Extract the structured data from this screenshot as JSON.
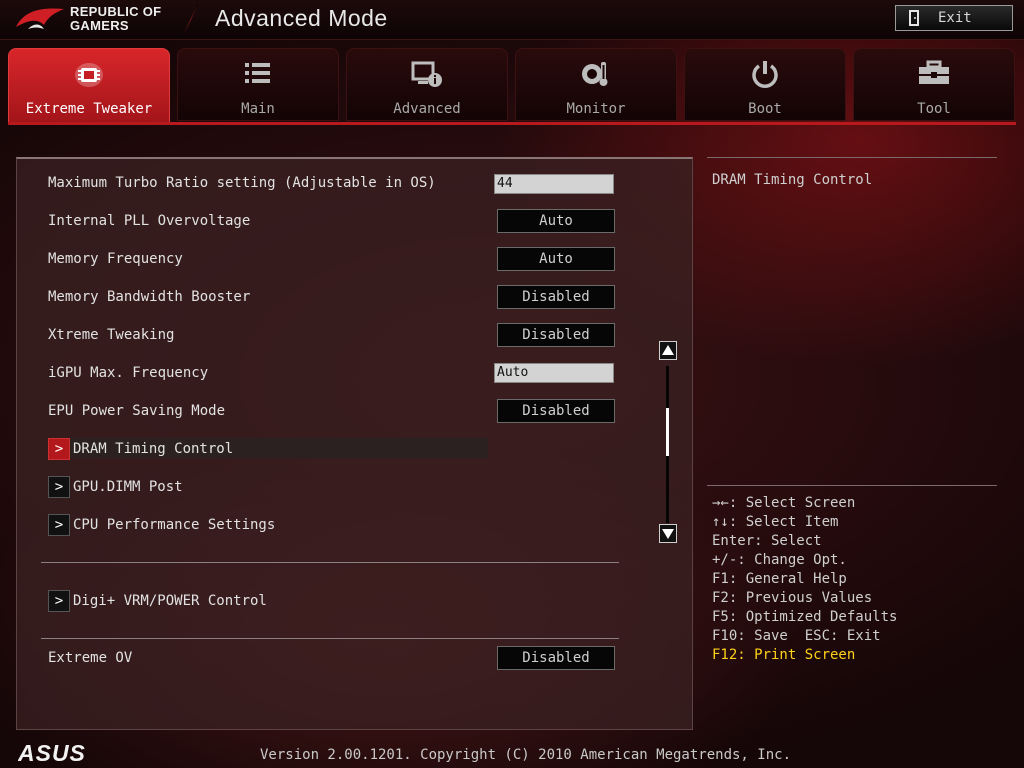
{
  "header": {
    "brand_line1": "REPUBLIC OF",
    "brand_line2": "GAMERS",
    "mode_title": "Advanced Mode",
    "exit_label": "Exit"
  },
  "tabs": [
    {
      "label": "Extreme Tweaker",
      "icon": "tweaker-icon",
      "active": true
    },
    {
      "label": "Main",
      "icon": "list-icon",
      "active": false
    },
    {
      "label": "Advanced",
      "icon": "advanced-info-icon",
      "active": false
    },
    {
      "label": "Monitor",
      "icon": "thermometer-icon",
      "active": false
    },
    {
      "label": "Boot",
      "icon": "power-icon",
      "active": false
    },
    {
      "label": "Tool",
      "icon": "toolbox-icon",
      "active": false
    }
  ],
  "settings": {
    "max_turbo": {
      "label": "Maximum Turbo Ratio setting (Adjustable in OS)",
      "value": "44"
    },
    "pll_overvoltage": {
      "label": "Internal PLL Overvoltage",
      "value": "Auto"
    },
    "memory_frequency": {
      "label": "Memory Frequency",
      "value": "Auto"
    },
    "memory_bandwidth_booster": {
      "label": "Memory Bandwidth Booster",
      "value": "Disabled"
    },
    "xtreme_tweaking": {
      "label": "Xtreme Tweaking",
      "value": "Disabled"
    },
    "igpu_max_frequency": {
      "label": "iGPU Max. Frequency",
      "value": "Auto"
    },
    "epu_power_saving": {
      "label": "EPU Power Saving Mode",
      "value": "Disabled"
    },
    "extreme_ov": {
      "label": "Extreme OV",
      "value": "Disabled"
    }
  },
  "submenus": {
    "dram_timing": "DRAM Timing Control",
    "gpu_dimm_post": "GPU.DIMM Post",
    "cpu_performance": "CPU Performance Settings",
    "digi_vrm": "Digi+ VRM/POWER Control"
  },
  "help": {
    "title": "DRAM Timing Control",
    "keys": [
      "→←: Select Screen",
      "↑↓: Select Item",
      "Enter: Select",
      "+/-: Change Opt.",
      "F1: General Help",
      "F2: Previous Values",
      "F5: Optimized Defaults",
      "F10: Save  ESC: Exit"
    ],
    "print_key": "F12: Print Screen"
  },
  "footer": {
    "brand": "ASUS",
    "version": "Version 2.00.1201. Copyright (C) 2010 American Megatrends, Inc."
  },
  "colors": {
    "accent_red": "#b8191d",
    "highlight_yellow": "#ffd21a"
  }
}
